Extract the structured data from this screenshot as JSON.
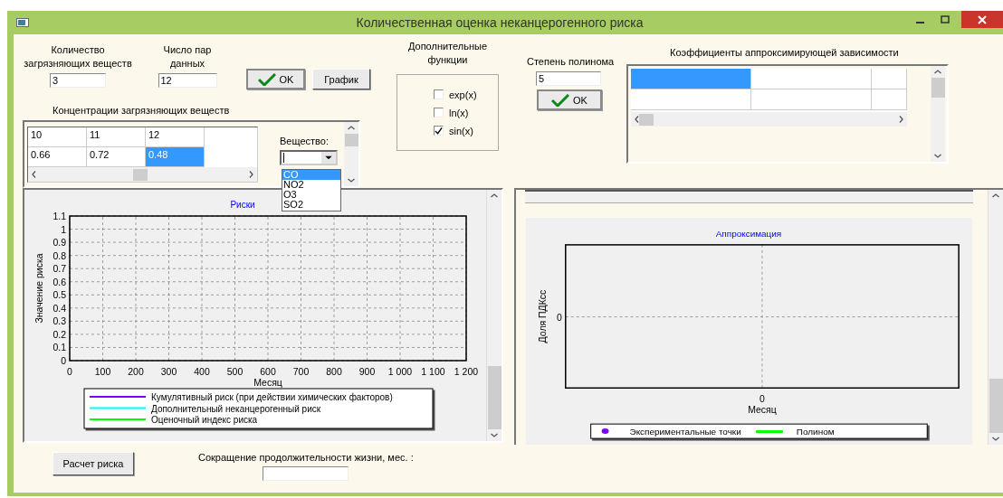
{
  "window": {
    "title": "Количественная оценка неканцерогенного риска"
  },
  "pollutant_count": {
    "label": "Количество загрязняющих веществ",
    "value": "3"
  },
  "pair_count": {
    "label": "Число пар данных",
    "value": "12"
  },
  "ok_button": "OK",
  "graph_button": "График",
  "concentrations": {
    "label": "Концентрации загрязняющих веществ",
    "rows": [
      [
        {
          "text": "10",
          "selected": false
        },
        {
          "text": "11",
          "selected": false
        },
        {
          "text": "12",
          "selected": false
        }
      ],
      [
        {
          "text": "0.66",
          "selected": false
        },
        {
          "text": "0.72",
          "selected": false
        },
        {
          "text": "0.48",
          "selected": true
        }
      ]
    ],
    "substance_label": "Вещество:",
    "substances": [
      {
        "label": "CO",
        "selected": true
      },
      {
        "label": "NO2",
        "selected": false
      },
      {
        "label": "O3",
        "selected": false
      },
      {
        "label": "SO2",
        "selected": false
      }
    ]
  },
  "extra_functions": {
    "label": "Дополнительные функции",
    "items": [
      {
        "label": "exp(x)",
        "checked": false
      },
      {
        "label": "ln(x)",
        "checked": false
      },
      {
        "label": "sin(x)",
        "checked": true
      }
    ]
  },
  "polynomial": {
    "label": "Степень полинома",
    "value": "5",
    "button": "OK"
  },
  "coefficients": {
    "label": "Коэффициенты аппроксимирующей зависимости",
    "rows": [
      [
        {
          "selected": true
        },
        {
          "selected": false
        },
        {
          "selected": false
        }
      ],
      [
        {
          "selected": false
        },
        {
          "selected": false
        },
        {
          "selected": false
        }
      ]
    ]
  },
  "risk_chart": {
    "title": "Риски",
    "xlabel": "Месяц",
    "ylabel": "Значение риска",
    "grid": true,
    "x_ticks": [
      "0",
      "100",
      "200",
      "300",
      "400",
      "500",
      "600",
      "700",
      "800",
      "900",
      "1 000",
      "1 100",
      "1 200"
    ],
    "y_ticks": [
      "1.1",
      "1",
      "0.9",
      "0.8",
      "0.7",
      "0.6",
      "0.5",
      "0.4",
      "0.3",
      "0.2",
      "0.1",
      "0"
    ],
    "legend": [
      {
        "name": "Кумулятивный риск (при действии химических факторов)",
        "color": "#8000ff"
      },
      {
        "name": "Дополнительный неканцерогенный риск",
        "color": "#00ffff"
      },
      {
        "name": "Оценочный индекс риска",
        "color": "#00ff00"
      }
    ]
  },
  "approx_chart": {
    "title": "Аппроксимация",
    "xlabel": "Месяц",
    "ylabel": "Доля ПДКсс",
    "x_tick": "0",
    "y_tick": "0",
    "legend": [
      {
        "name": "Экспериментальные точки",
        "color": "#8000ff",
        "kind": "points"
      },
      {
        "name": "Полином",
        "color": "#00ff00",
        "kind": "line"
      }
    ]
  },
  "calc_button": "Расчет риска",
  "life_reduction": {
    "label": "Сокращение продолжительности жизни, мес. :"
  }
}
